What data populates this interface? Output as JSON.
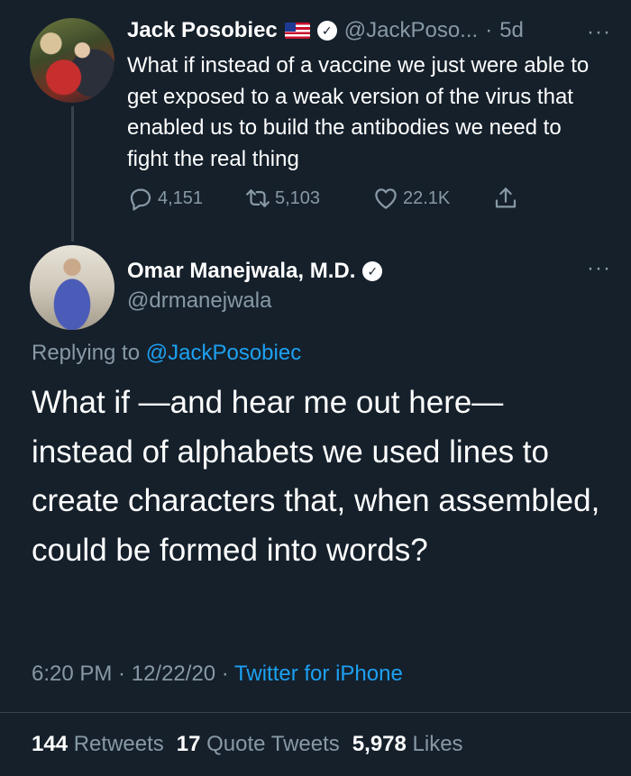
{
  "parent_tweet": {
    "display_name": "Jack Posobiec",
    "handle": "@JackPoso...",
    "time_sep": "·",
    "time": "5d",
    "more": "···",
    "text": "What if instead of a vaccine we just were able to get exposed to a weak version of the virus that enabled us to build the antibodies we need to fight the real thing",
    "replies": "4,151",
    "retweets": "5,103",
    "likes": "22.1K",
    "icons": [
      "flag-us-icon",
      "verified-icon",
      "reply-icon",
      "retweet-icon",
      "like-icon",
      "share-icon"
    ]
  },
  "main_tweet": {
    "display_name": "Omar Manejwala, M.D.",
    "handle": "@drmanejwala",
    "more": "···",
    "replying_prefix": "Replying to ",
    "replying_mention": "@JackPosobiec",
    "text": "What if —and hear me out here— instead of alphabets we used lines to create characters that, when assembled, could be formed into words?",
    "time": "6:20 PM",
    "sep1": " · ",
    "date": "12/22/20",
    "sep2": " · ",
    "source": "Twitter for iPhone",
    "retweets_count": "144",
    "retweets_label": "Retweets",
    "quotes_count": "17",
    "quotes_label": "Quote Tweets",
    "likes_count": "5,978",
    "likes_label": "Likes"
  },
  "colors": {
    "background": "#15202b",
    "text": "#ffffff",
    "muted": "#8899a6",
    "accent": "#1da1f2",
    "line": "#38444d"
  }
}
